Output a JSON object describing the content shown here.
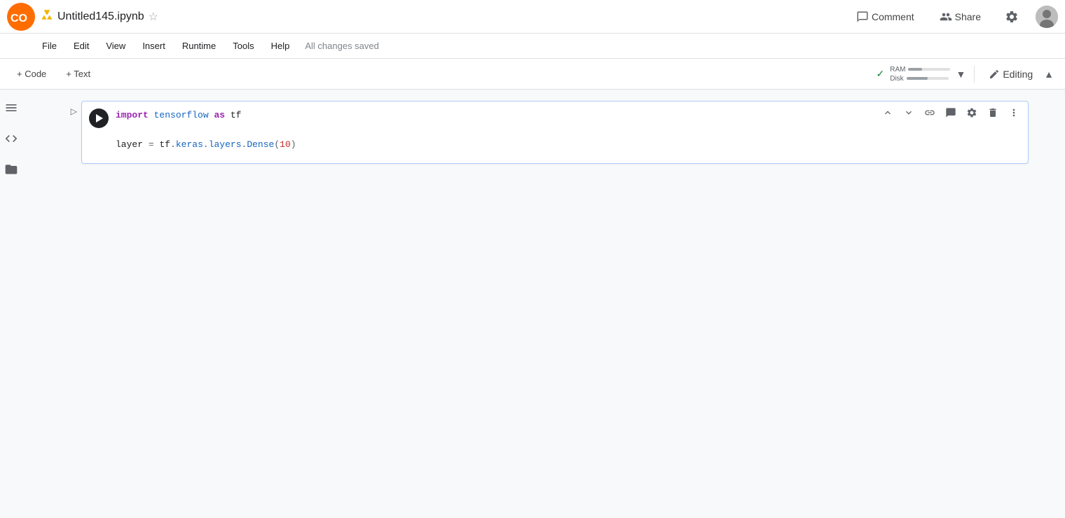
{
  "header": {
    "file_title": "Untitled145.ipynb",
    "file_icon": "📄",
    "all_changes_label": "All changes saved",
    "comment_label": "Comment",
    "share_label": "Share",
    "editing_label": "Editing"
  },
  "menubar": {
    "items": [
      "File",
      "Edit",
      "View",
      "Insert",
      "Runtime",
      "Tools",
      "Help"
    ]
  },
  "toolbar": {
    "add_code_label": "+ Code",
    "add_text_label": "+ Text",
    "ram_label": "RAM",
    "disk_label": "Disk",
    "ram_fill_width": "20",
    "disk_fill_width": "30"
  },
  "cell": {
    "code_line1": "import tensorflow as tf",
    "code_line2": "layer = tf.keras.layers.Dense(10)"
  },
  "sidebar": {
    "icons": [
      "menu",
      "code",
      "folder"
    ]
  }
}
